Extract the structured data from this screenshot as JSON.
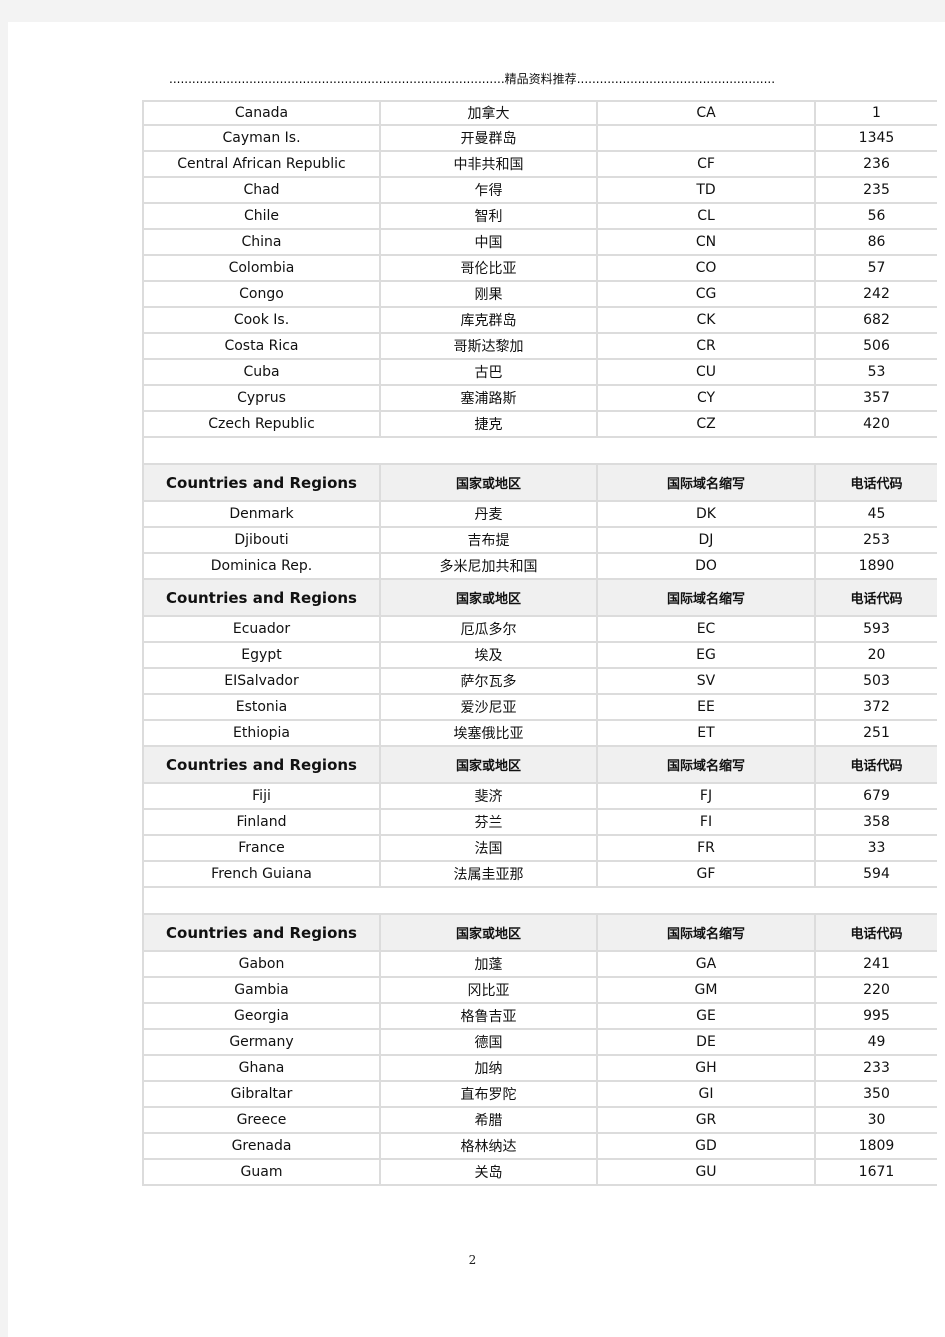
{
  "header": {
    "left_dots": "........................................................................................",
    "title": "精品资料推荐",
    "right_dots": "......................................................................................................."
  },
  "column_headers": [
    "Countries and Regions",
    "国家或地区",
    "国际域名缩写",
    "电话代码"
  ],
  "sections": [
    {
      "has_header": false,
      "gap_after": true,
      "rows": [
        [
          "Canada",
          "加拿大",
          "CA",
          "1"
        ],
        [
          "Cayman Is.",
          "开曼群岛",
          "",
          "1345"
        ],
        [
          "Central African Republic",
          "中非共和国",
          "CF",
          "236"
        ],
        [
          "Chad",
          "乍得",
          "TD",
          "235"
        ],
        [
          "Chile",
          "智利",
          "CL",
          "56"
        ],
        [
          "China",
          "中国",
          "CN",
          "86"
        ],
        [
          "Colombia",
          "哥伦比亚",
          "CO",
          "57"
        ],
        [
          "Congo",
          "刚果",
          "CG",
          "242"
        ],
        [
          "Cook Is.",
          "库克群岛",
          "CK",
          "682"
        ],
        [
          "Costa Rica",
          "哥斯达黎加",
          "CR",
          "506"
        ],
        [
          "Cuba",
          "古巴",
          "CU",
          "53"
        ],
        [
          "Cyprus",
          "塞浦路斯",
          "CY",
          "357"
        ],
        [
          "Czech Republic",
          "捷克",
          "CZ",
          "420"
        ]
      ]
    },
    {
      "has_header": true,
      "gap_after": false,
      "rows": [
        [
          "Denmark",
          "丹麦",
          "DK",
          "45"
        ],
        [
          "Djibouti",
          "吉布提",
          "DJ",
          "253"
        ],
        [
          "Dominica Rep.",
          "多米尼加共和国",
          "DO",
          "1890"
        ]
      ]
    },
    {
      "has_header": true,
      "gap_after": false,
      "rows": [
        [
          "Ecuador",
          "厄瓜多尔",
          "EC",
          "593"
        ],
        [
          "Egypt",
          "埃及",
          "EG",
          "20"
        ],
        [
          "EISalvador",
          "萨尔瓦多",
          "SV",
          "503"
        ],
        [
          "Estonia",
          "爱沙尼亚",
          "EE",
          "372"
        ],
        [
          "Ethiopia",
          "埃塞俄比亚",
          "ET",
          "251"
        ]
      ]
    },
    {
      "has_header": true,
      "gap_after": true,
      "rows": [
        [
          "Fiji",
          "斐济",
          "FJ",
          "679"
        ],
        [
          "Finland",
          "芬兰",
          "FI",
          "358"
        ],
        [
          "France",
          "法国",
          "FR",
          "33"
        ],
        [
          "French Guiana",
          "法属圭亚那",
          "GF",
          "594"
        ]
      ]
    },
    {
      "has_header": true,
      "gap_after": false,
      "rows": [
        [
          "Gabon",
          "加蓬",
          "GA",
          "241"
        ],
        [
          "Gambia",
          "冈比亚",
          "GM",
          "220"
        ],
        [
          "Georgia",
          "格鲁吉亚",
          "GE",
          "995"
        ],
        [
          "Germany",
          "德国",
          "DE",
          "49"
        ],
        [
          "Ghana",
          "加纳",
          "GH",
          "233"
        ],
        [
          "Gibraltar",
          "直布罗陀",
          "GI",
          "350"
        ],
        [
          "Greece",
          "希腊",
          "GR",
          "30"
        ],
        [
          "Grenada",
          "格林纳达",
          "GD",
          "1809"
        ],
        [
          "Guam",
          "关岛",
          "GU",
          "1671"
        ]
      ]
    }
  ],
  "page_number": "2"
}
